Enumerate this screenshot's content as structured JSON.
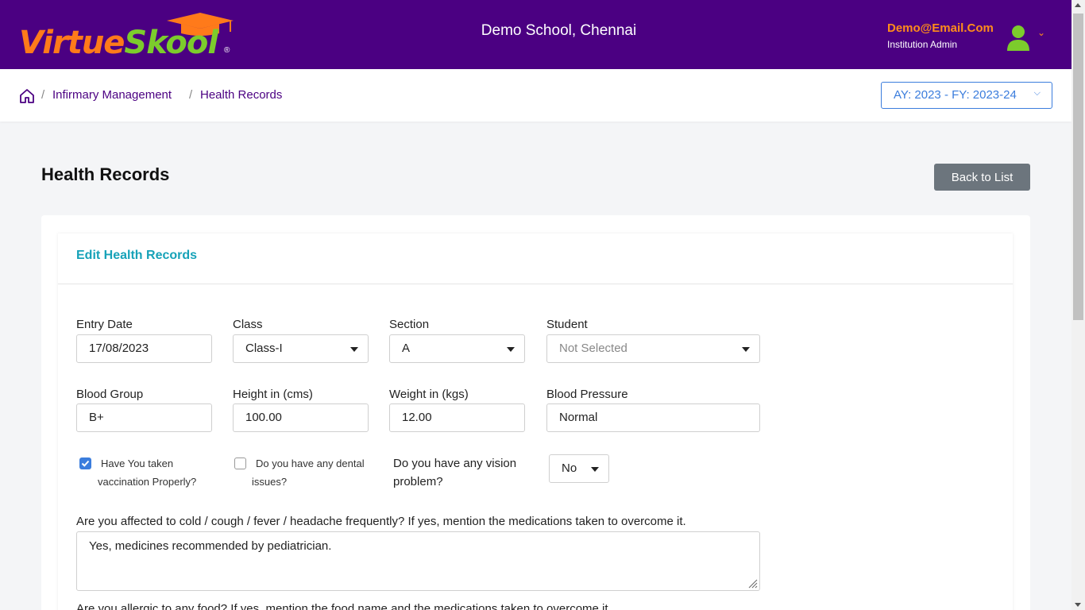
{
  "brand": {
    "part1": "Virtue",
    "part2": "Skool",
    "reg": "®"
  },
  "header": {
    "school_name": "Demo School, Chennai",
    "user_email": "Demo@Email.Com",
    "user_role": "Institution Admin"
  },
  "breadcrumb": {
    "sep": "/",
    "items": [
      "Infirmary Management",
      "Health Records"
    ]
  },
  "academic_year": "AY: 2023 - FY: 2023-24",
  "page": {
    "title": "Health Records",
    "back_label": "Back to List",
    "card_title": "Edit Health Records"
  },
  "form": {
    "entry_date": {
      "label": "Entry Date",
      "value": "17/08/2023"
    },
    "class": {
      "label": "Class",
      "value": "Class-I"
    },
    "section": {
      "label": "Section",
      "value": "A"
    },
    "student": {
      "label": "Student",
      "value": "Not Selected"
    },
    "blood_group": {
      "label": "Blood Group",
      "value": "B+"
    },
    "height": {
      "label": "Height in (cms)",
      "value": "100.00"
    },
    "weight": {
      "label": "Weight in (kgs)",
      "value": "12.00"
    },
    "blood_pressure": {
      "label": "Blood Pressure",
      "value": "Normal"
    },
    "vaccination": {
      "label_line1": "Have You taken",
      "label_line2": "vaccination Properly?",
      "checked": true
    },
    "dental": {
      "label_line1": "Do you have any dental",
      "label_line2": "issues?",
      "checked": false
    },
    "vision": {
      "label": "Do you have any vision problem?",
      "value": "No"
    },
    "cold_question": {
      "label": "Are you affected to cold / cough / fever / headache frequently? If yes, mention the medications taken to overcome it.",
      "value": "Yes, medicines recommended by pediatrician."
    },
    "next_question": "Are you allergic to any food? If yes, mention the food name and the medications taken to overcome it."
  },
  "colors": {
    "header_bg": "#4b0082",
    "accent": "#3b7ddd",
    "card_title": "#17a2b8",
    "email": "#ff8c1a"
  }
}
